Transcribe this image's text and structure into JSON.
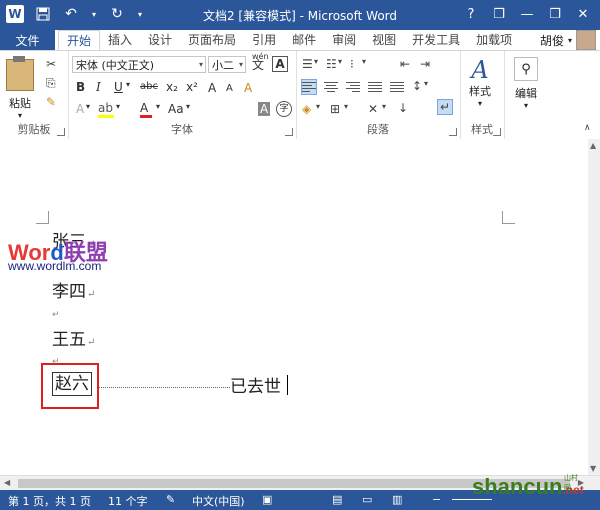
{
  "titlebar": {
    "title": "文档2 [兼容模式] - Microsoft Word",
    "logo": "W",
    "help": "?",
    "minimize": "—",
    "restore": "❐",
    "close": "✕"
  },
  "tabs": {
    "file": "文件",
    "items": [
      "开始",
      "插入",
      "设计",
      "页面布局",
      "引用",
      "邮件",
      "审阅",
      "视图",
      "开发工具",
      "加载项"
    ],
    "user": "胡俊"
  },
  "ribbon": {
    "clipboard": {
      "label": "剪贴板",
      "paste": "粘贴"
    },
    "font": {
      "label": "字体",
      "font_name": "宋体 (中文正文)",
      "font_size": "小二",
      "wen": "wén",
      "wen_char": "文",
      "a_box": "A",
      "bold": "B",
      "italic": "I",
      "underline": "U",
      "strike": "abc",
      "sub": "x₂",
      "sup": "x²",
      "grow": "A",
      "shrink": "A",
      "aa": "Aa",
      "clear": "A",
      "char_shading": "A",
      "enclose": "字"
    },
    "paragraph": {
      "label": "段落"
    },
    "styles": {
      "label": "样式",
      "button": "样式"
    },
    "editing": {
      "label": "编辑",
      "button": "编辑"
    }
  },
  "document": {
    "lines": [
      "张三",
      "李四",
      "王五"
    ],
    "highlighted": "赵六",
    "remark": "已去世",
    "para_mark": "↵"
  },
  "watermark": {
    "word": "Wor",
    "d": "d",
    "lianmeng": "联盟",
    "url": "www.wordlm.com"
  },
  "brand": {
    "name": "shancun",
    "net": ".net",
    "sub": "山村网"
  },
  "status": {
    "page": "第 1 页，共 1 页",
    "words": "11 个字",
    "lang": "中文(中国)"
  }
}
